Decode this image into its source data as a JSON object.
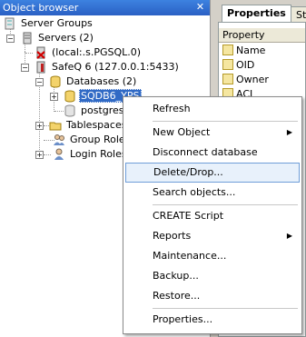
{
  "object_browser": {
    "title": "Object browser",
    "close_glyph": "✕",
    "tree": {
      "server_groups": "Server Groups",
      "servers": "Servers (2)",
      "local_server": "(local:.s.PGSQL.0)",
      "safeq_server": "SafeQ 6 (127.0.0.1:5433)",
      "databases": "Databases (2)",
      "db_selected": "SQDB6_YPS",
      "db_postgres": "postgres",
      "tablespaces": "Tablespaces",
      "group_roles": "Group Roles",
      "login_roles": "Login Roles"
    }
  },
  "properties": {
    "tabs": [
      "Properties",
      "St"
    ],
    "column_header": "Property",
    "rows": [
      "Name",
      "OID",
      "Owner",
      "ACL"
    ]
  },
  "context_menu": {
    "items": [
      {
        "label": "Refresh"
      },
      {
        "label": "New Object",
        "submenu": "▶"
      },
      {
        "label": "Disconnect database"
      },
      {
        "label": "Delete/Drop..."
      },
      {
        "label": "Search objects..."
      },
      {
        "label": "CREATE Script"
      },
      {
        "label": "Reports",
        "submenu": "▶"
      },
      {
        "label": "Maintenance..."
      },
      {
        "label": "Backup..."
      },
      {
        "label": "Restore..."
      },
      {
        "label": "Properties..."
      }
    ],
    "highlighted": "Delete/Drop..."
  },
  "colors": {
    "title_bar": "#2a6ad1",
    "selection": "#316ac5",
    "menu_hover": "#e8f1fb"
  }
}
